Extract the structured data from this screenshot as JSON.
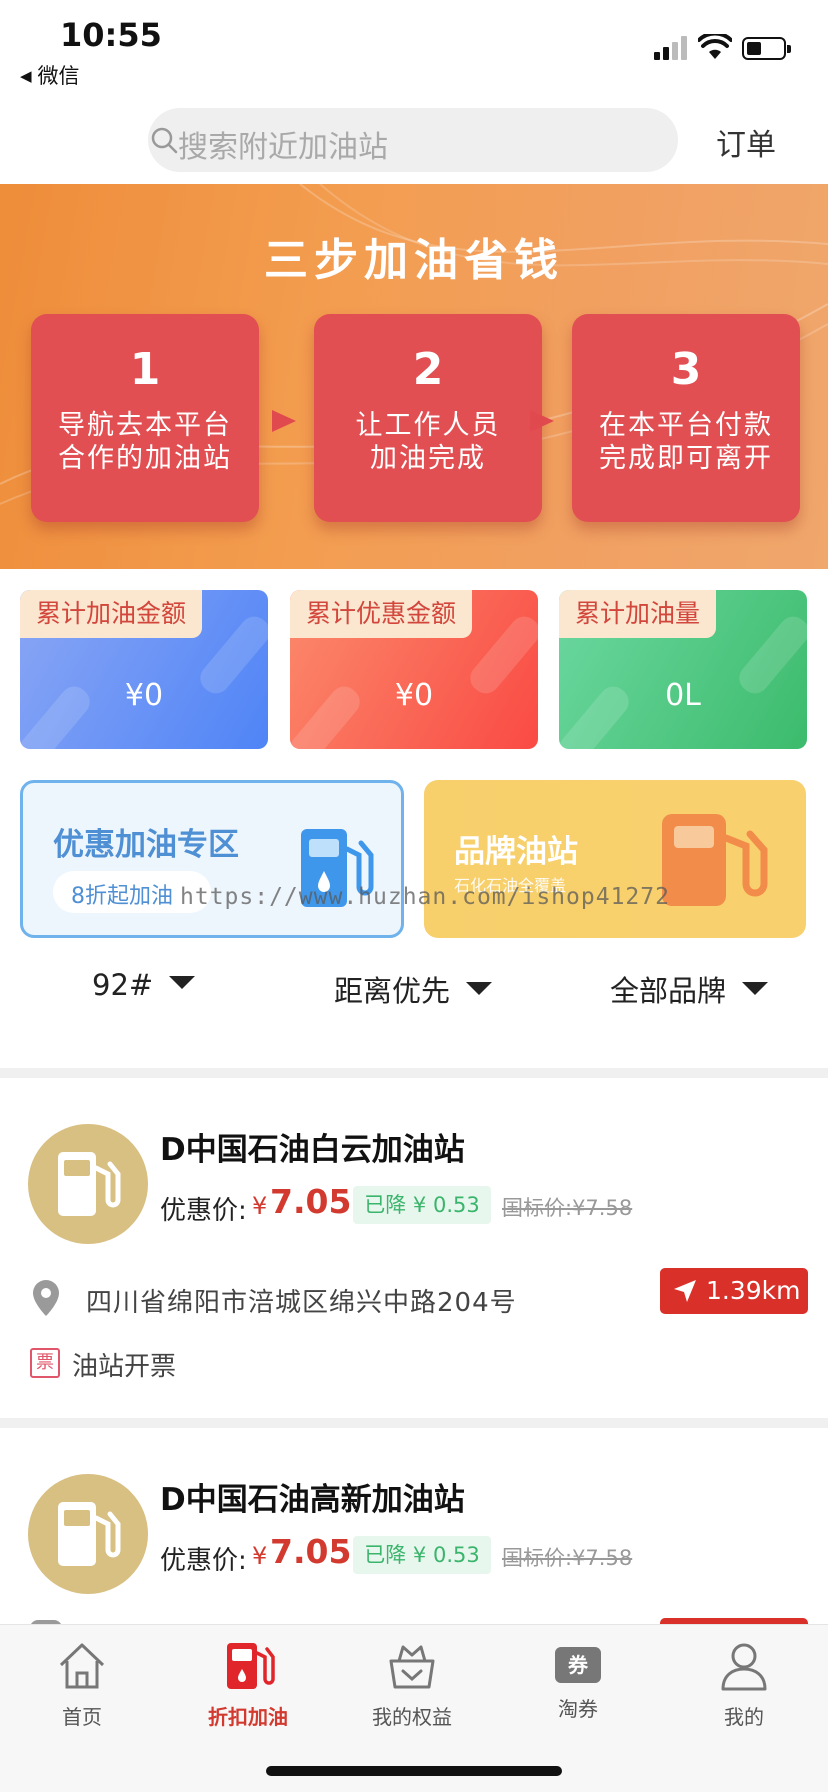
{
  "status_bar": {
    "time": "10:55",
    "back_app": "微信"
  },
  "search": {
    "placeholder": "搜索附近加油站",
    "orders_label": "订单"
  },
  "banner": {
    "title": "三步加油省钱",
    "steps": [
      {
        "num": "1",
        "line1": "导航去本平台",
        "line2": "合作的加油站"
      },
      {
        "num": "2",
        "line1": "让工作人员",
        "line2": "加油完成"
      },
      {
        "num": "3",
        "line1": "在本平台付款",
        "line2": "完成即可离开"
      }
    ]
  },
  "stats": [
    {
      "label": "累计加油金额",
      "value": "¥0",
      "color": "#5b8df7"
    },
    {
      "label": "累计优惠金额",
      "value": "¥0",
      "color": "#fb5b4e"
    },
    {
      "label": "累计加油量",
      "value": "0L",
      "color": "#47c47c"
    }
  ],
  "promos": {
    "discount": {
      "title": "优惠加油专区",
      "subtitle": "8折起加油"
    },
    "brand": {
      "title": "品牌油站",
      "subtitle": "石化石油全覆盖"
    }
  },
  "watermark": "https://www.huzhan.com/ishop41272",
  "filters": {
    "fuel": "92#",
    "sort": "距离优先",
    "brand": "全部品牌"
  },
  "stations": [
    {
      "name": "D中国石油白云加油站",
      "price_label": "优惠价:",
      "price_currency": "¥",
      "price": "7.05",
      "drop": "已降 ¥ 0.53",
      "std_price": "国标价:¥7.58",
      "address": "四川省绵阳市涪城区绵兴中路204号",
      "distance": "1.39km",
      "invoice_badge": "票",
      "invoice_text": "油站开票"
    },
    {
      "name": "D中国石油高新加油站",
      "price_label": "优惠价:",
      "price_currency": "¥",
      "price": "7.05",
      "drop": "已降 ¥ 0.53",
      "std_price": "国标价:¥7.58"
    }
  ],
  "tabs": [
    {
      "label": "首页",
      "icon": "home-icon"
    },
    {
      "label": "折扣加油",
      "icon": "fuel-pump-icon",
      "active": true
    },
    {
      "label": "我的权益",
      "icon": "crown-box-icon"
    },
    {
      "label": "淘券",
      "icon": "coupon-icon",
      "badge": "券"
    },
    {
      "label": "我的",
      "icon": "user-icon"
    }
  ],
  "colors": {
    "accent_red": "#d33a2f",
    "banner_orange": "#ee8d3a",
    "step_red": "#e24f53",
    "gold": "#d8bf82"
  }
}
